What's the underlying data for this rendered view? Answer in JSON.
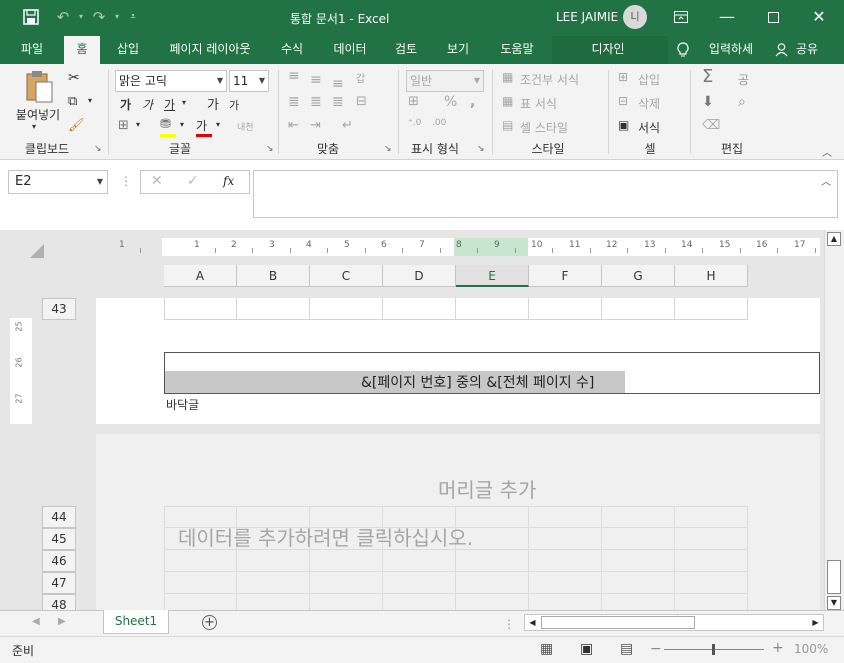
{
  "window": {
    "title": "통합 문서1 - Excel",
    "user": "LEE JAIMIE",
    "avatar_initial": "L|"
  },
  "tabs": [
    {
      "label": "파일"
    },
    {
      "label": "홈"
    },
    {
      "label": "삽입"
    },
    {
      "label": "페이지 레이아웃"
    },
    {
      "label": "수식"
    },
    {
      "label": "데이터"
    },
    {
      "label": "검토"
    },
    {
      "label": "보기"
    },
    {
      "label": "도움말"
    }
  ],
  "contextual_tab": "디자인",
  "tell_me": "입력하세",
  "share": "공유",
  "ribbon": {
    "clipboard": {
      "label": "클립보드",
      "paste": "붙여넣기"
    },
    "font": {
      "label": "글꼴",
      "font_name": "맑은 고딕",
      "font_size": "11",
      "bold": "가",
      "italic": "가",
      "underline": "가",
      "grow": "가",
      "shrink": "가",
      "font_color": "가",
      "phonetic": "내천"
    },
    "alignment": {
      "label": "맞춤",
      "wrap": "갑"
    },
    "number": {
      "label": "표시 형식",
      "format": "일반",
      "percent": "%",
      "comma": ","
    },
    "styles": {
      "label": "스타일",
      "conditional": "조건부 서식",
      "table": "표 서식",
      "cell": "셀 스타일"
    },
    "cells": {
      "label": "셀",
      "insert": "삽입",
      "delete": "삭제",
      "format": "서식"
    },
    "editing": {
      "label": "편집",
      "sort": "공"
    }
  },
  "formula_bar": {
    "name_box": "E2",
    "fx": "fx",
    "value": ""
  },
  "ruler": {
    "ticks": [
      "1",
      "1",
      "2",
      "3",
      "4",
      "5",
      "6",
      "7",
      "8",
      "9",
      "10",
      "11",
      "12",
      "13",
      "14",
      "15",
      "16",
      "17"
    ]
  },
  "columns": [
    "A",
    "B",
    "C",
    "D",
    "E",
    "F",
    "G",
    "H"
  ],
  "selected_column": "E",
  "rows_page1": [
    "43"
  ],
  "vruler_marks": [
    "25",
    "26",
    "27"
  ],
  "footer": {
    "content": "&[페이지 번호] 중의 &[전체 페이지 수]",
    "label": "바닥글"
  },
  "page2": {
    "header_placeholder": "머리글 추가",
    "data_placeholder": "데이터를 추가하려면 클릭하십시오.",
    "rows": [
      "44",
      "45",
      "46",
      "47",
      "48"
    ]
  },
  "sheet_tabs": [
    {
      "label": "Sheet1"
    }
  ],
  "status": {
    "ready": "준비",
    "zoom": "100%"
  }
}
